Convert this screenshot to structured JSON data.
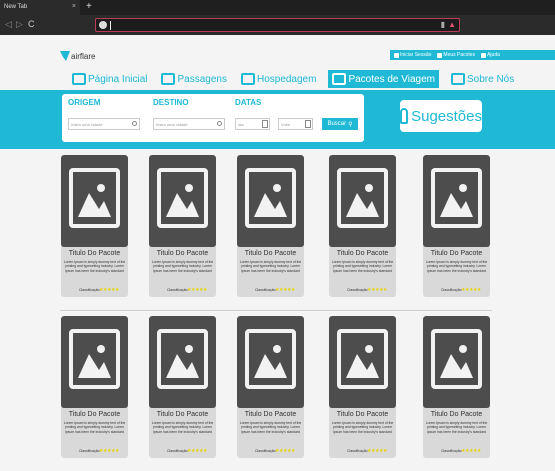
{
  "browser": {
    "tab_title": "New Tab",
    "tab_close": "×",
    "new_tab": "+",
    "back": "◁",
    "forward": "▷",
    "reload": "C"
  },
  "site": {
    "brand": "airflare",
    "top_links": [
      "Iniciar Sessão",
      "Meus Pacotes",
      "Ajuda"
    ],
    "nav": [
      {
        "label": "Página Inicial",
        "active": false
      },
      {
        "label": "Passagens",
        "active": false
      },
      {
        "label": "Hospedagem",
        "active": false
      },
      {
        "label": "Pacotes de Viagem",
        "active": true
      },
      {
        "label": "Sobre Nós",
        "active": false
      }
    ],
    "accent_color": "#1fb9d6"
  },
  "search": {
    "origin_label": "ORIGEM",
    "origin_placeholder": "Insira uma cidade",
    "dest_label": "DESTINO",
    "dest_placeholder": "Insira uma cidade",
    "dates_label": "DATAS",
    "date_from_placeholder": "Ida",
    "date_to_placeholder": "Volta",
    "button": "Buscar",
    "suggestions": "Sugestões"
  },
  "packages": [
    {
      "title": "Titulo Do Pacote",
      "desc": "Lorem Ipsum is simply dummy text of the printing and typesetting industry. Lorem Ipsum has been the industry's standard",
      "rating_label": "Classificação",
      "stars": "★★★★★"
    },
    {
      "title": "Titulo Do Pacote",
      "desc": "Lorem Ipsum is simply dummy text of the printing and typesetting industry. Lorem Ipsum has been the industry's standard",
      "rating_label": "Classificação",
      "stars": "★★★★★"
    },
    {
      "title": "Titulo Do Pacote",
      "desc": "Lorem Ipsum is simply dummy text of the printing and typesetting industry. Lorem Ipsum has been the industry's standard",
      "rating_label": "Classificação",
      "stars": "★★★★★"
    },
    {
      "title": "Titulo Do Pacote",
      "desc": "Lorem Ipsum is simply dummy text of the printing and typesetting industry. Lorem Ipsum has been the industry's standard",
      "rating_label": "Classificação",
      "stars": "★★★★★"
    },
    {
      "title": "Titulo Do Pacote",
      "desc": "Lorem Ipsum is simply dummy text of the printing and typesetting industry. Lorem Ipsum has been the industry's standard",
      "rating_label": "Classificação",
      "stars": "★★★★★"
    },
    {
      "title": "Titulo Do Pacote",
      "desc": "Lorem Ipsum is simply dummy text of the printing and typesetting industry. Lorem Ipsum has been the industry's standard",
      "rating_label": "Classificação",
      "stars": "★★★★★"
    },
    {
      "title": "Titulo Do Pacote",
      "desc": "Lorem Ipsum is simply dummy text of the printing and typesetting industry. Lorem Ipsum has been the industry's standard",
      "rating_label": "Classificação",
      "stars": "★★★★★"
    },
    {
      "title": "Titulo Do Pacote",
      "desc": "Lorem Ipsum is simply dummy text of the printing and typesetting industry. Lorem Ipsum has been the industry's standard",
      "rating_label": "Classificação",
      "stars": "★★★★★"
    },
    {
      "title": "Titulo Do Pacote",
      "desc": "Lorem Ipsum is simply dummy text of the printing and typesetting industry. Lorem Ipsum has been the industry's standard",
      "rating_label": "Classificação",
      "stars": "★★★★★"
    },
    {
      "title": "Titulo Do Pacote",
      "desc": "Lorem Ipsum is simply dummy text of the printing and typesetting industry. Lorem Ipsum has been the industry's standard",
      "rating_label": "Classificação",
      "stars": "★★★★★"
    }
  ]
}
